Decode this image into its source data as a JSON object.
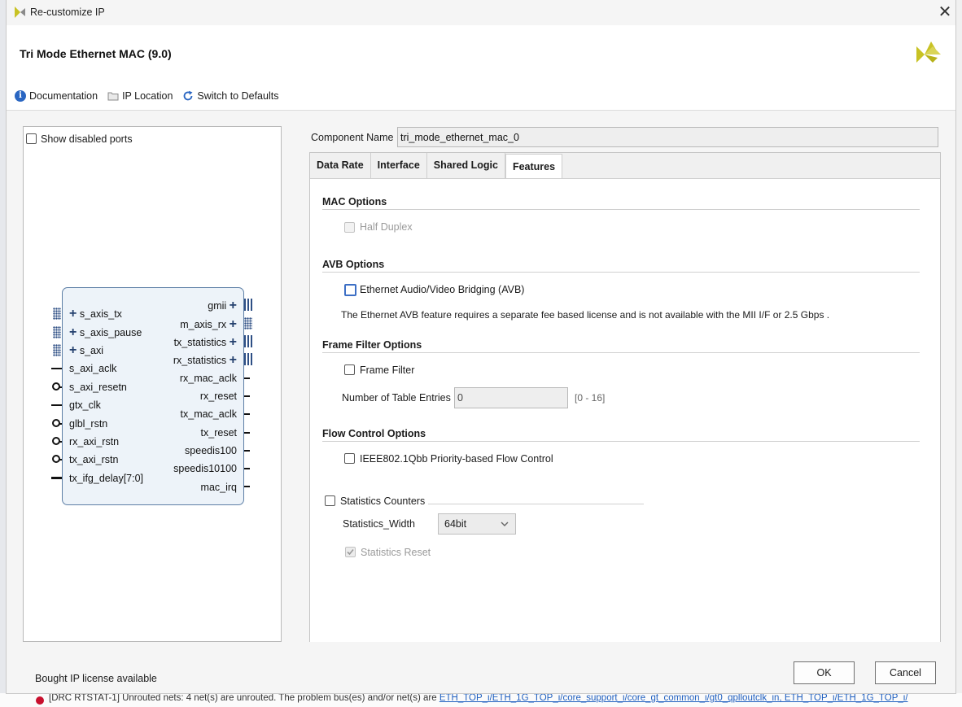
{
  "window": {
    "title": "Re-customize IP"
  },
  "header": {
    "title": "Tri Mode Ethernet MAC (9.0)"
  },
  "toolbar": {
    "documentation": "Documentation",
    "ip_location": "IP Location",
    "switch_defaults": "Switch to Defaults"
  },
  "symbol": {
    "show_disabled_ports": "Show disabled ports",
    "left_ports": [
      "s_axis_tx",
      "s_axis_pause",
      "s_axi",
      "s_axi_aclk",
      "s_axi_resetn",
      "gtx_clk",
      "glbl_rstn",
      "rx_axi_rstn",
      "tx_axi_rstn",
      "tx_ifg_delay[7:0]"
    ],
    "right_ports": [
      "gmii",
      "m_axis_rx",
      "tx_statistics",
      "rx_statistics",
      "rx_mac_aclk",
      "rx_reset",
      "tx_mac_aclk",
      "tx_reset",
      "speedis100",
      "speedis10100",
      "mac_irq"
    ]
  },
  "component": {
    "label": "Component Name",
    "value": "tri_mode_ethernet_mac_0"
  },
  "tabs": [
    "Data Rate",
    "Interface",
    "Shared Logic",
    "Features"
  ],
  "active_tab": "Features",
  "features": {
    "mac_options": {
      "title": "MAC Options",
      "half_duplex": "Half Duplex"
    },
    "avb_options": {
      "title": "AVB Options",
      "avb_label": "Ethernet Audio/Video Bridging (AVB)",
      "note": "The Ethernet AVB feature requires a separate fee based license and is not available with the MII I/F or 2.5 Gbps ."
    },
    "frame_filter": {
      "title": "Frame Filter Options",
      "frame_filter_label": "Frame Filter",
      "table_entries_label": "Number of Table Entries",
      "table_entries_value": "0",
      "range": "[0 - 16]"
    },
    "flow_control": {
      "title": "Flow Control Options",
      "label": "IEEE802.1Qbb Priority-based Flow Control"
    },
    "statistics": {
      "label": "Statistics Counters",
      "width_label": "Statistics_Width",
      "width_value": "64bit",
      "reset_label": "Statistics Reset"
    }
  },
  "footer": {
    "license": "Bought IP license available",
    "ok": "OK",
    "cancel": "Cancel"
  },
  "background": {
    "message": "[DRC RTSTAT-1] Unrouted nets: 4 net(s) are unrouted. The problem bus(es) and/or net(s) are ",
    "link": "ETH_TOP_i/ETH_1G_TOP_i/core_support_i/core_gt_common_i/gt0_qplloutclk_in, ETH_TOP_i/ETH_1G_TOP_i/"
  },
  "colors": {
    "accent": "#2a66c2",
    "xilinx_logo": "#c8c224",
    "block_fill": "#edf3f9",
    "error": "#c8102e"
  }
}
